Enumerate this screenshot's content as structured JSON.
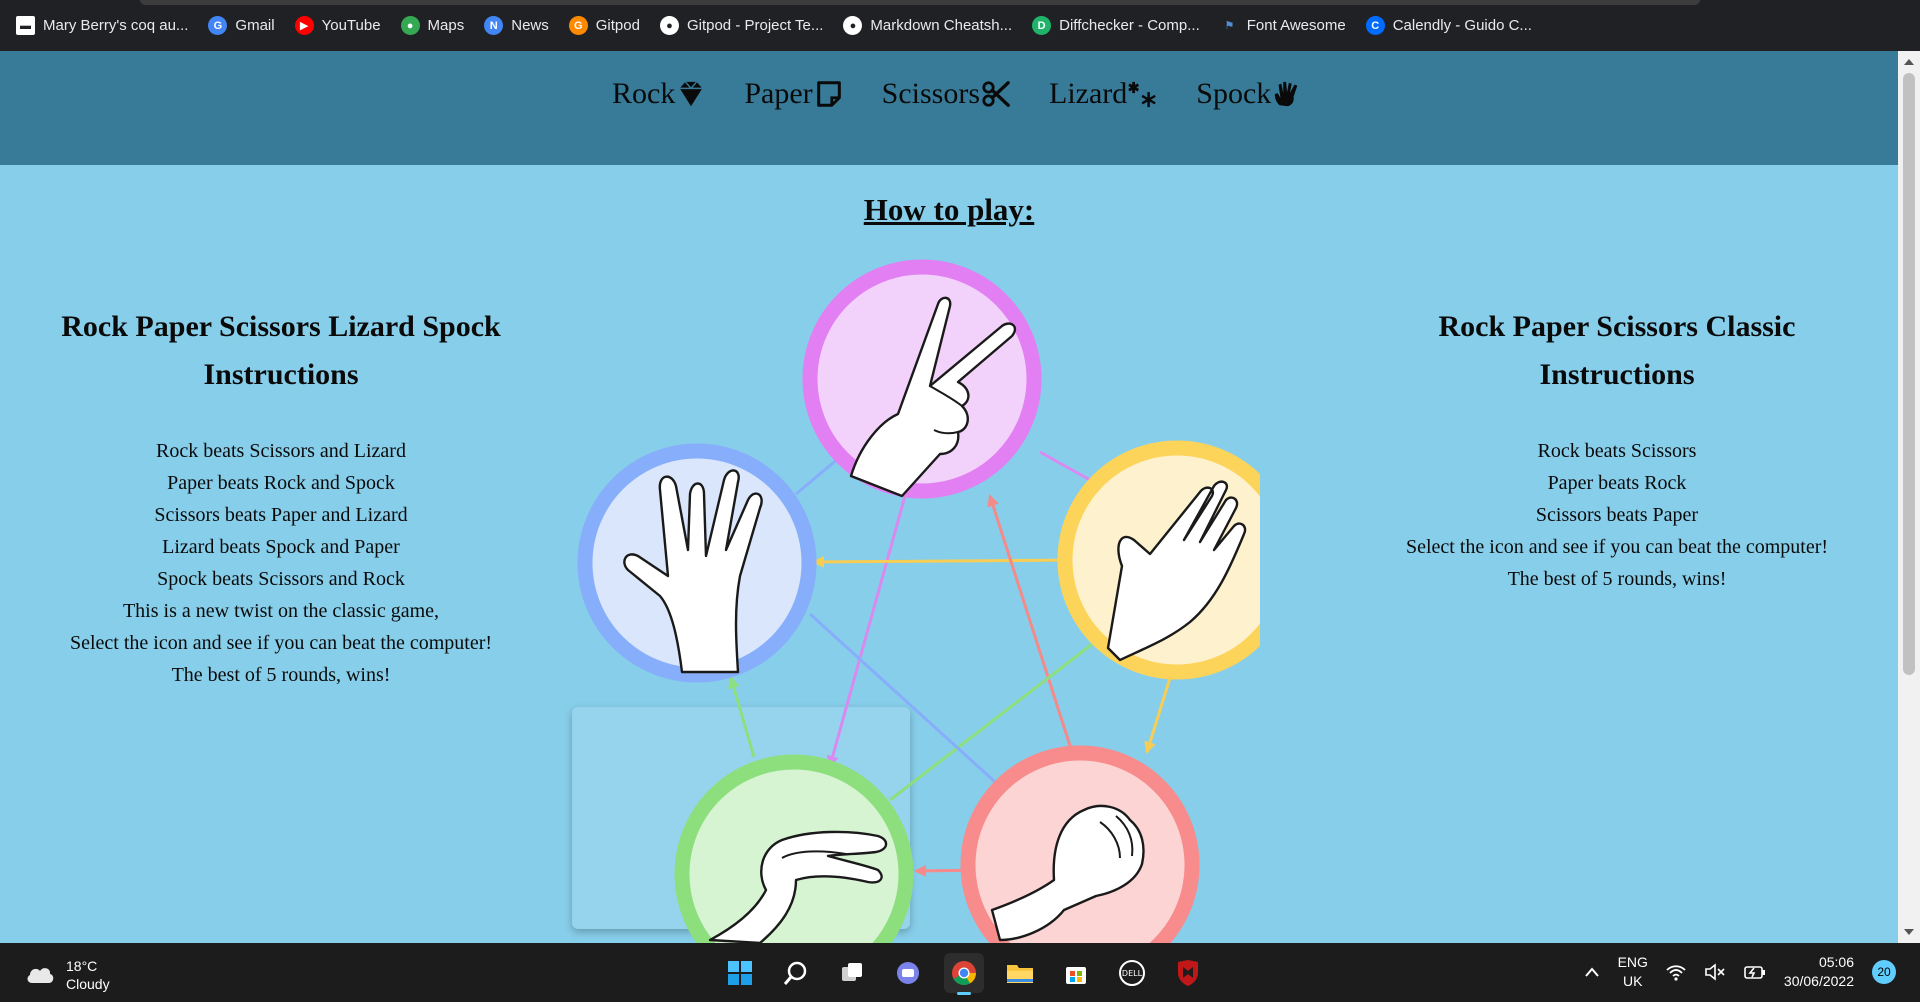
{
  "bookmarks": [
    {
      "label": "Mary Berry's coq au...",
      "icon": "page-icon",
      "color": "#ffffff"
    },
    {
      "label": "Gmail",
      "icon": "google-icon",
      "color": "#4285f4"
    },
    {
      "label": "YouTube",
      "icon": "youtube-icon",
      "color": "#ff0000"
    },
    {
      "label": "Maps",
      "icon": "maps-icon",
      "color": "#34a853"
    },
    {
      "label": "News",
      "icon": "news-icon",
      "color": "#4285f4"
    },
    {
      "label": "Gitpod",
      "icon": "gitpod-icon",
      "color": "#ff8a00"
    },
    {
      "label": "Gitpod - Project Te...",
      "icon": "github-icon",
      "color": "#ffffff"
    },
    {
      "label": "Markdown Cheatsh...",
      "icon": "github-icon",
      "color": "#ffffff"
    },
    {
      "label": "Diffchecker - Comp...",
      "icon": "diffchecker-icon",
      "color": "#1fb46a"
    },
    {
      "label": "Font Awesome",
      "icon": "flag-icon",
      "color": "#538dd7"
    },
    {
      "label": "Calendly - Guido C...",
      "icon": "calendly-icon",
      "color": "#006bff"
    }
  ],
  "nav": [
    {
      "label": "Rock",
      "icon": "gem-icon"
    },
    {
      "label": "Paper",
      "icon": "paper-icon"
    },
    {
      "label": "Scissors",
      "icon": "scissors-icon"
    },
    {
      "label": "Lizard",
      "icon": "lizard-icon"
    },
    {
      "label": "Spock",
      "icon": "spock-hand-icon"
    }
  ],
  "main": {
    "how_to_play": "How to play:",
    "left": {
      "title_line1": "Rock Paper Scissors Lizard Spock",
      "title_line2": "Instructions",
      "lines": [
        "Rock beats Scissors and Lizard",
        "Paper beats Rock and Spock",
        "Scissors beats Paper and Lizard",
        "Lizard beats Spock and Paper",
        "Spock beats Scissors and Rock",
        "This is a new twist on the classic game,",
        "Select the icon and see if you can beat the computer!",
        "The best of 5 rounds, wins!"
      ]
    },
    "right": {
      "title_line1": "Rock Paper Scissors Classic",
      "title_line2": "Instructions",
      "lines": [
        "Rock beats Scissors",
        "Paper beats Rock",
        "Scissors beats Paper",
        "Select the icon and see if you can beat the computer!",
        "The best of 5 rounds, wins!"
      ]
    }
  },
  "diagram": {
    "nodes": [
      {
        "id": "scissors",
        "ring": "#e27ff2",
        "fill": "#f2d2fb"
      },
      {
        "id": "paper",
        "ring": "#fdd45a",
        "fill": "#fdf1ce"
      },
      {
        "id": "rock",
        "ring": "#f88b8b",
        "fill": "#fcd4d4"
      },
      {
        "id": "lizard",
        "ring": "#8ddf7e",
        "fill": "#d6f3d2"
      },
      {
        "id": "spock",
        "ring": "#87aefb",
        "fill": "#d9e6fc"
      }
    ]
  },
  "taskbar": {
    "temp": "18°C",
    "weather": "Cloudy",
    "lang1": "ENG",
    "lang2": "UK",
    "time": "05:06",
    "date": "30/06/2022",
    "notifications": "20"
  }
}
